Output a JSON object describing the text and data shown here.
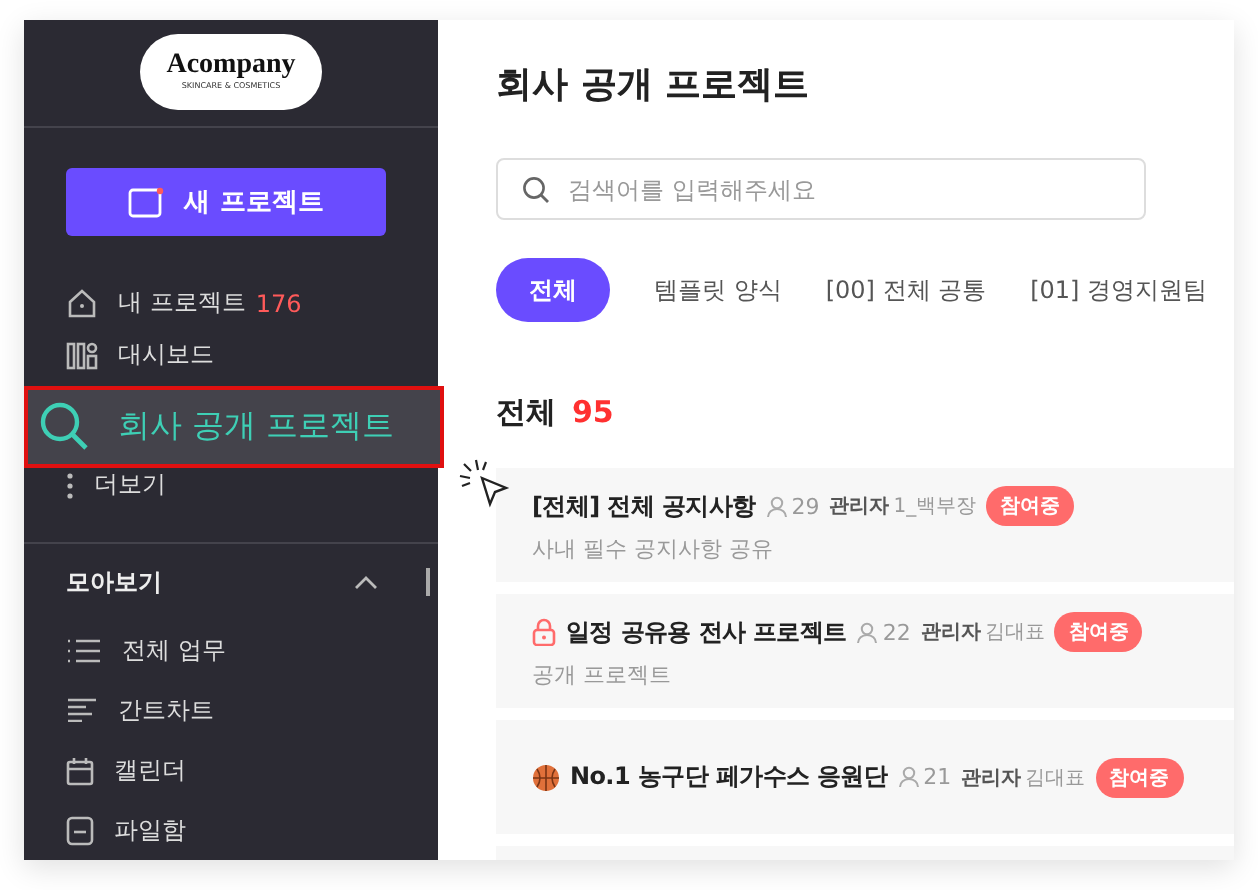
{
  "logo": {
    "name": "Acompany",
    "tagline": "SKINCARE & COSMETICS"
  },
  "new_project_button": "새 프로젝트",
  "nav": [
    {
      "label": "내 프로젝트",
      "count": "176",
      "selected": false
    },
    {
      "label": "대시보드",
      "selected": false
    },
    {
      "label": "회사 공개 프로젝트",
      "selected": true
    },
    {
      "label": "더보기",
      "selected": false
    }
  ],
  "section": {
    "title": "모아보기",
    "expanded": true,
    "items": [
      {
        "label": "전체 업무"
      },
      {
        "label": "간트차트"
      },
      {
        "label": "캘린더"
      },
      {
        "label": "파일함"
      }
    ]
  },
  "page_title": "회사 공개 프로젝트",
  "search": {
    "placeholder": "검색어를 입력해주세요"
  },
  "tabs": [
    {
      "label": "전체",
      "selected": true
    },
    {
      "label": "템플릿 양식",
      "selected": false
    },
    {
      "label": "[00] 전체 공통",
      "selected": false
    },
    {
      "label": "[01] 경영지원팀",
      "selected": false
    }
  ],
  "total": {
    "label": "전체",
    "count": "95"
  },
  "projects": [
    {
      "kind": "plain",
      "title": "[전체] 전체 공지사항",
      "members": "29",
      "manager_label": "관리자",
      "manager": "1_백부장",
      "badge": "참여중",
      "description": "사내 필수 공지사항 공유"
    },
    {
      "kind": "locked",
      "title": "일정 공유용 전사 프로젝트",
      "members": "22",
      "manager_label": "관리자",
      "manager": "김대표",
      "badge": "참여중",
      "description": "공개 프로젝트"
    },
    {
      "kind": "basketball",
      "title": "No.1 농구단 페가수스 응원단",
      "members": "21",
      "manager_label": "관리자",
      "manager": "김대표",
      "badge": "참여중"
    }
  ]
}
